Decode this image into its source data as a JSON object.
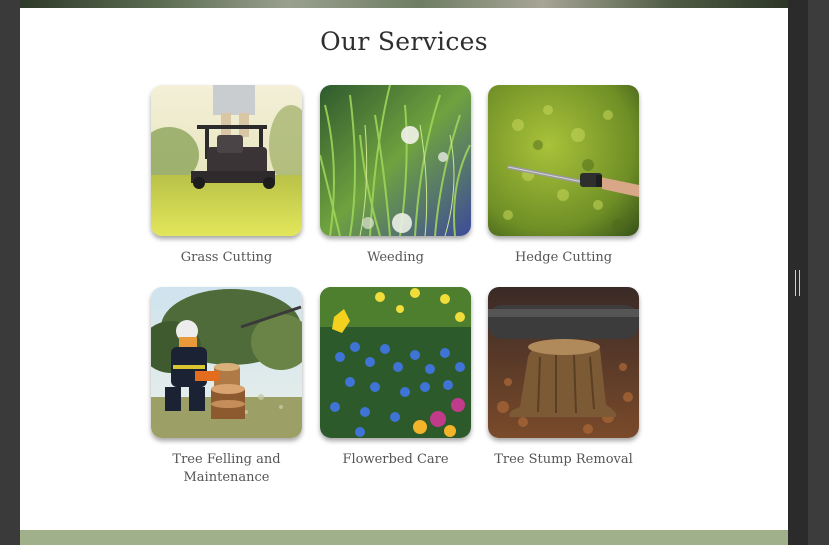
{
  "section": {
    "title": "Our Services"
  },
  "services": [
    {
      "label": "Grass Cutting",
      "image": "lawn-mower-photo"
    },
    {
      "label": "Weeding",
      "image": "dandelion-grass-photo"
    },
    {
      "label": "Hedge Cutting",
      "image": "hedge-trimmer-photo"
    },
    {
      "label": "Tree Felling and Maintenance",
      "image": "chainsaw-worker-photo"
    },
    {
      "label": "Flowerbed Care",
      "image": "flowerbed-photo"
    },
    {
      "label": "Tree Stump Removal",
      "image": "tree-stump-photo"
    }
  ],
  "colors": {
    "page_bg": "#ffffff",
    "footer": "#9fb08a",
    "window_bg": "#3a3a3a"
  }
}
